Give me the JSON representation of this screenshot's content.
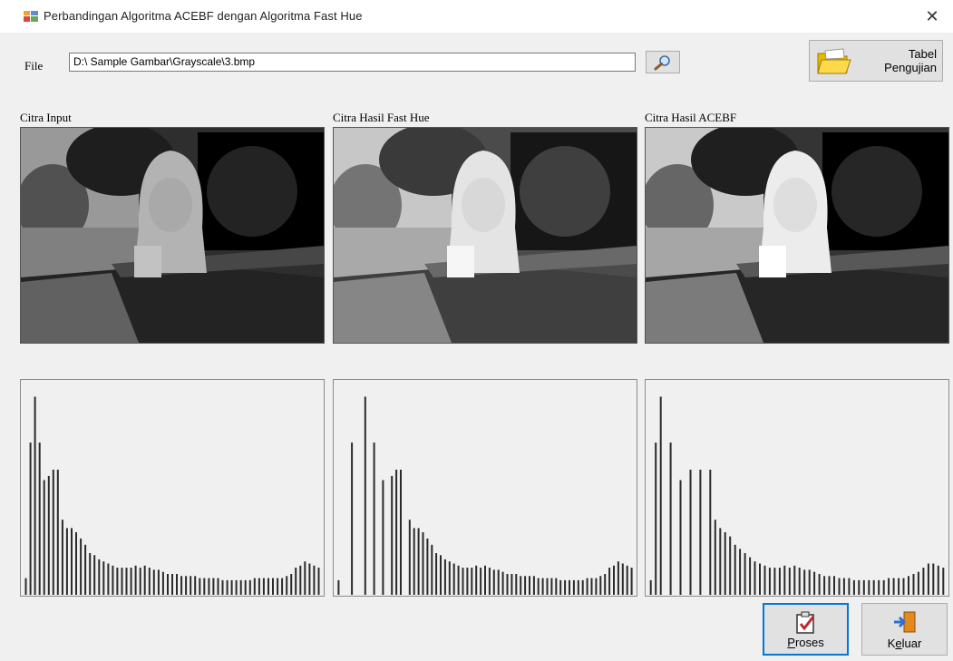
{
  "window": {
    "title": "Perbandingan Algoritma ACEBF dengan Algoritma Fast Hue",
    "close_glyph": "✕"
  },
  "file": {
    "label": "File",
    "path": "D:\\ Sample Gambar\\Grayscale\\3.bmp"
  },
  "buttons": {
    "browse_icon": "magnifier-icon",
    "tabel_line1": "Tabel",
    "tabel_line2": "Pengujian",
    "proses": "Proses",
    "keluar": "Keluar"
  },
  "panels": [
    {
      "title": "Citra Input",
      "brightness": 0.82,
      "contrast": 1.25
    },
    {
      "title": "Citra Hasil Fast Hue",
      "brightness": 1.12,
      "contrast": 1.05
    },
    {
      "title": "Citra Hasil ACEBF",
      "brightness": 1.05,
      "contrast": 1.35
    }
  ],
  "histograms": [
    {
      "name": "histogram-input",
      "bars": [
        0.08,
        0.73,
        0.95,
        0.73,
        0.55,
        0.57,
        0.6,
        0.6,
        0.36,
        0.32,
        0.32,
        0.3,
        0.27,
        0.24,
        0.2,
        0.19,
        0.17,
        0.16,
        0.15,
        0.14,
        0.13,
        0.13,
        0.13,
        0.13,
        0.14,
        0.13,
        0.14,
        0.13,
        0.12,
        0.12,
        0.11,
        0.1,
        0.1,
        0.1,
        0.09,
        0.09,
        0.09,
        0.09,
        0.08,
        0.08,
        0.08,
        0.08,
        0.08,
        0.07,
        0.07,
        0.07,
        0.07,
        0.07,
        0.07,
        0.07,
        0.08,
        0.08,
        0.08,
        0.08,
        0.08,
        0.08,
        0.08,
        0.09,
        0.1,
        0.13,
        0.14,
        0.16,
        0.15,
        0.14,
        0.13
      ]
    },
    {
      "name": "histogram-fast-hue",
      "bars": [
        0.07,
        0,
        0,
        0.73,
        0,
        0,
        0.95,
        0,
        0.73,
        0,
        0.55,
        0,
        0.57,
        0.6,
        0.6,
        0,
        0.36,
        0.32,
        0.32,
        0.3,
        0.27,
        0.24,
        0.2,
        0.19,
        0.17,
        0.16,
        0.15,
        0.14,
        0.13,
        0.13,
        0.13,
        0.14,
        0.13,
        0.14,
        0.13,
        0.12,
        0.12,
        0.11,
        0.1,
        0.1,
        0.1,
        0.09,
        0.09,
        0.09,
        0.09,
        0.08,
        0.08,
        0.08,
        0.08,
        0.08,
        0.07,
        0.07,
        0.07,
        0.07,
        0.07,
        0.07,
        0.08,
        0.08,
        0.08,
        0.09,
        0.1,
        0.13,
        0.14,
        0.16,
        0.15,
        0.14,
        0.13
      ]
    },
    {
      "name": "histogram-acebf",
      "bars": [
        0.07,
        0.73,
        0.95,
        0,
        0.73,
        0,
        0.55,
        0,
        0.6,
        0,
        0.6,
        0,
        0.6,
        0.36,
        0.32,
        0.3,
        0.28,
        0.24,
        0.22,
        0.2,
        0.18,
        0.16,
        0.15,
        0.14,
        0.13,
        0.13,
        0.13,
        0.14,
        0.13,
        0.14,
        0.13,
        0.12,
        0.12,
        0.11,
        0.1,
        0.09,
        0.09,
        0.09,
        0.08,
        0.08,
        0.08,
        0.07,
        0.07,
        0.07,
        0.07,
        0.07,
        0.07,
        0.07,
        0.08,
        0.08,
        0.08,
        0.08,
        0.09,
        0.1,
        0.11,
        0.13,
        0.15,
        0.15,
        0.14,
        0.13
      ]
    }
  ],
  "colors": {
    "focus_border": "#0078d7",
    "bar": "#2a2a2a",
    "window_bg": "#f0f0f0"
  }
}
